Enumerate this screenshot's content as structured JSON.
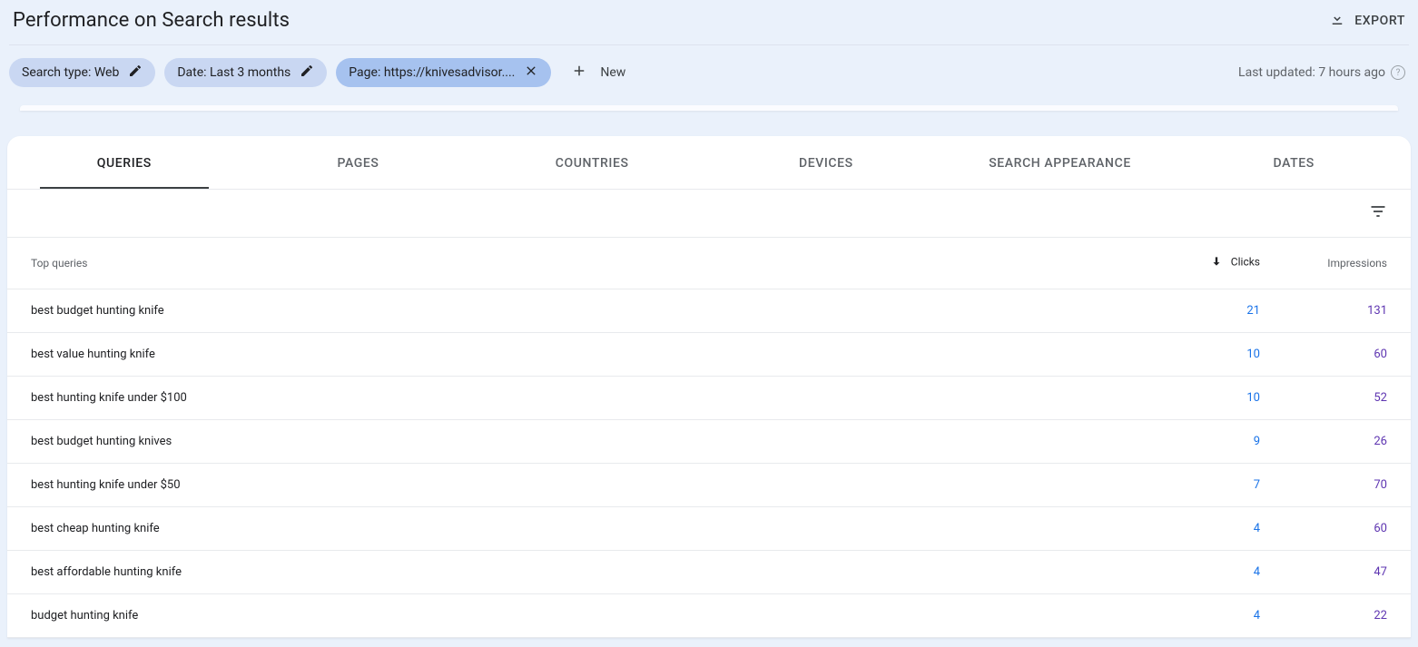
{
  "header": {
    "title": "Performance on Search results",
    "export_label": "EXPORT"
  },
  "filters": {
    "chips": [
      {
        "label": "Search type: Web",
        "trailing": "edit",
        "style": "light"
      },
      {
        "label": "Date: Last 3 months",
        "trailing": "edit",
        "style": "light"
      },
      {
        "label": "Page: https://knivesadvisor....",
        "trailing": "close",
        "style": "dark"
      }
    ],
    "new_label": "New",
    "last_updated": "Last updated: 7 hours ago"
  },
  "tabs": [
    "QUERIES",
    "PAGES",
    "COUNTRIES",
    "DEVICES",
    "SEARCH APPEARANCE",
    "DATES"
  ],
  "active_tab_index": 0,
  "table": {
    "columns": {
      "query": "Top queries",
      "clicks": "Clicks",
      "impressions": "Impressions"
    },
    "sort_column": "clicks",
    "rows": [
      {
        "query": "best budget hunting knife",
        "clicks": 21,
        "impressions": 131
      },
      {
        "query": "best value hunting knife",
        "clicks": 10,
        "impressions": 60
      },
      {
        "query": "best hunting knife under $100",
        "clicks": 10,
        "impressions": 52
      },
      {
        "query": "best budget hunting knives",
        "clicks": 9,
        "impressions": 26
      },
      {
        "query": "best hunting knife under $50",
        "clicks": 7,
        "impressions": 70
      },
      {
        "query": "best cheap hunting knife",
        "clicks": 4,
        "impressions": 60
      },
      {
        "query": "best affordable hunting knife",
        "clicks": 4,
        "impressions": 47
      },
      {
        "query": "budget hunting knife",
        "clicks": 4,
        "impressions": 22
      }
    ]
  }
}
